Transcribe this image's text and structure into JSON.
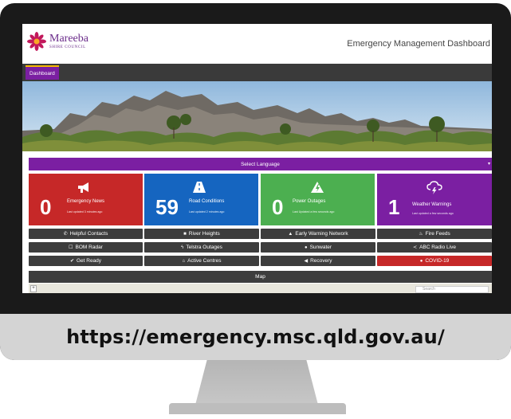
{
  "header": {
    "logo_name": "Mareeba",
    "logo_sub": "SHIRE COUNCIL",
    "title": "Emergency Management Dashboard"
  },
  "nav": {
    "active_tab": "Dashboard"
  },
  "language": {
    "label": "Select Language"
  },
  "tiles": [
    {
      "count": "0",
      "title": "Emergency News",
      "updated": "Last updated 3 minutes ago",
      "icon": "megaphone-icon",
      "color": "#c62828"
    },
    {
      "count": "59",
      "title": "Road Conditions",
      "updated": "Last updated 2 minutes ago",
      "icon": "road-icon",
      "color": "#1565c0"
    },
    {
      "count": "0",
      "title": "Power Outages",
      "updated": "Last Updated a few seconds ago",
      "icon": "power-icon",
      "color": "#4caf50"
    },
    {
      "count": "1",
      "title": "Weather Warnings",
      "updated": "Last updated a few seconds ago",
      "icon": "storm-cloud-icon",
      "color": "#7b1fa2"
    }
  ],
  "buttons": {
    "helpful_contacts": "Helpful Contacts",
    "river_heights": "River Heights",
    "early_warning": "Early Warning Network",
    "fire_feeds": "Fire Feeds",
    "bom_radar": "BOM Radar",
    "telstra_outages": "Telstra Outages",
    "sunwater": "Sunwater",
    "abc_radio": "ABC Radio Live",
    "get_ready": "Get Ready",
    "active_centres": "Active Centres",
    "recovery": "Recovery",
    "covid": "COVID-19"
  },
  "map": {
    "label": "Map",
    "search_placeholder": "Search"
  },
  "url": "https://emergency.msc.qld.gov.au/"
}
